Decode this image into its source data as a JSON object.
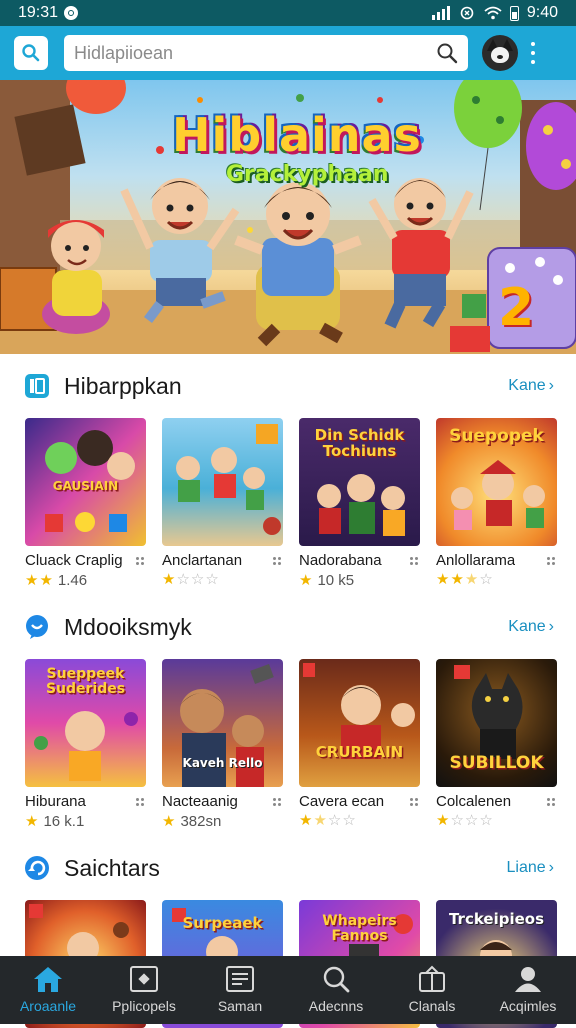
{
  "status_bar": {
    "time": "19:31",
    "right_time": "9:40"
  },
  "search": {
    "placeholder": "Hidlapiioean"
  },
  "hero": {
    "title": "Hiblainas",
    "subtitle": "Grackyphaan",
    "dice_number": "2"
  },
  "sections": [
    {
      "title": "Hibarppkan",
      "more": "Kane",
      "items": [
        {
          "name": "Cluack Craplig",
          "stars": 2,
          "rating_text": "1.46",
          "thumb_text": "GAUSIAIN"
        },
        {
          "name": "Anclartanan",
          "stars": 1,
          "rating_text": "",
          "thumb_text": ""
        },
        {
          "name": "Nadorabana",
          "stars": 1,
          "rating_text": "10 k5",
          "thumb_text": "Din Schidk Tochiuns"
        },
        {
          "name": "Anlollarama",
          "stars": 2.5,
          "rating_text": "",
          "thumb_text": "Suepopek"
        }
      ]
    },
    {
      "title": "Mdooiksmyk",
      "more": "Kane",
      "items": [
        {
          "name": "Hiburana",
          "stars": 1,
          "rating_text": "16 k.1",
          "thumb_text": "Sueppeek Suderides"
        },
        {
          "name": "Nacteaanig",
          "stars": 1,
          "rating_text": "382sn",
          "thumb_text": "Kaveh Rello"
        },
        {
          "name": "Cavera ecan",
          "stars": 1.5,
          "rating_text": "",
          "thumb_text": "CRURBAIN"
        },
        {
          "name": "Colcalenen",
          "stars": 1,
          "rating_text": "",
          "thumb_text": "SUBILLOK"
        }
      ]
    },
    {
      "title": "Saichtars",
      "more": "Liane",
      "items": [
        {
          "thumb_text": ""
        },
        {
          "thumb_text": "Surpeaek"
        },
        {
          "thumb_text": "Whapeirs Fannos"
        },
        {
          "thumb_text": "Trckeipieos"
        }
      ]
    }
  ],
  "bottom_nav": [
    {
      "label": "Aroaanle",
      "icon": "home-icon",
      "active": true
    },
    {
      "label": "Pplicopels",
      "icon": "apps-icon",
      "active": false
    },
    {
      "label": "Saman",
      "icon": "list-icon",
      "active": false
    },
    {
      "label": "Adecnns",
      "icon": "search-icon",
      "active": false
    },
    {
      "label": "Clanals",
      "icon": "channels-icon",
      "active": false
    },
    {
      "label": "Acqimles",
      "icon": "profile-icon",
      "active": false
    }
  ],
  "colors": {
    "accent": "#1ea7d6",
    "status_bar": "#0d5a63",
    "nav_bg": "#24282b",
    "star": "#f2b600",
    "link": "#1a8fc0"
  }
}
